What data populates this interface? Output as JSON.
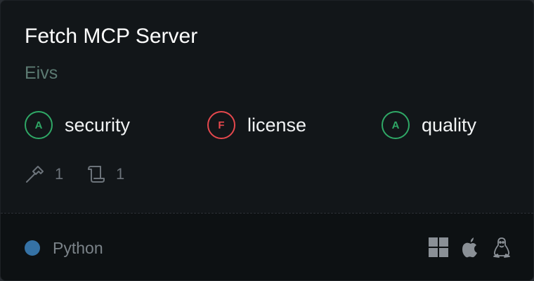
{
  "card": {
    "title": "Fetch MCP Server",
    "author": "Eivs"
  },
  "badges": [
    {
      "grade": "A",
      "label": "security",
      "status": "pass",
      "color": "#2fa866"
    },
    {
      "grade": "F",
      "label": "license",
      "status": "fail",
      "color": "#e5484d"
    },
    {
      "grade": "A",
      "label": "quality",
      "status": "pass",
      "color": "#2fa866"
    }
  ],
  "stats": {
    "tools": {
      "icon": "hammer-icon",
      "count": "1"
    },
    "prompts": {
      "icon": "scroll-icon",
      "count": "1"
    }
  },
  "footer": {
    "language": "Python",
    "language_color": "#3572a5",
    "platforms": [
      "windows-icon",
      "apple-icon",
      "linux-icon"
    ]
  }
}
